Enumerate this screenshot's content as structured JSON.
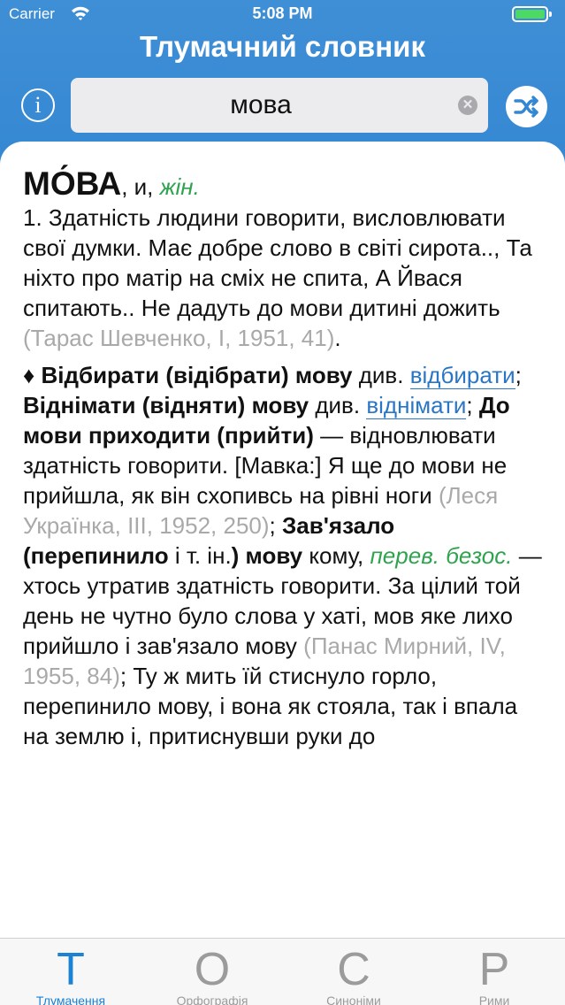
{
  "status_bar": {
    "carrier": "Carrier",
    "time": "5:08 PM"
  },
  "header": {
    "title": "Тлумачний словник",
    "info_label": "i"
  },
  "search": {
    "value": "мова"
  },
  "entry": {
    "headword": "МО́ВА",
    "grammar": ", и, ",
    "gender": "жін.",
    "sense_number": "1. ",
    "definition": "Здатність людини говорити, висловлювати свої думки. ",
    "quote1": "Має добре слово в світі сирота.., Та ніхто про матір на сміх не спита, А Йвася спитають.. Не дадуть до мови дитині дожить ",
    "source1": "(Тарас Шевченко, І, 1951, 41)",
    "dot1": ".",
    "diamond": "♦ ",
    "idiom1": "Відбирати (відібрати) мову",
    "div1": " див. ",
    "link1": "відбирати",
    "semi1": "; ",
    "idiom2": "Віднімати (відняти) мову",
    "div2": " див. ",
    "link2": "віднімати",
    "semi2": "; ",
    "idiom3": "До мови приходити (прийти)",
    "def3": " — відновлювати здатність говорити. [Мавка:] Я ще до мови не прийшла, як він схопивсь на рівні ноги ",
    "source2": "(Леся Українка, III, 1952, 250)",
    "semi3": "; ",
    "idiom4a": "Зав'язало (перепинило",
    "idiom4b": " і т. ін.",
    "idiom4c": ") мову",
    "kom": " кому, ",
    "per": "перев. безос.",
    "def4": " — хтось утратив здатність говорити. За цілий той день не чутно було слова у хаті, мов яке лихо прийшло і зав'язало мову ",
    "source3": "(Панас Мирний, IV, 1955, 84)",
    "tail": "; Ту ж мить їй стиснуло горло, перепинило мову, і вона як стояла, так і впала на землю і, притиснувши руки до"
  },
  "tabs": [
    {
      "glyph": "Т",
      "label": "Тлумачення"
    },
    {
      "glyph": "О",
      "label": "Орфографія"
    },
    {
      "glyph": "С",
      "label": "Синоніми"
    },
    {
      "glyph": "Р",
      "label": "Рими"
    }
  ],
  "colors": {
    "header": "#3487d2",
    "accent": "#1b82d4",
    "green": "#2fa34f",
    "link": "#2a76c6",
    "source_grey": "#a9a9a9"
  }
}
